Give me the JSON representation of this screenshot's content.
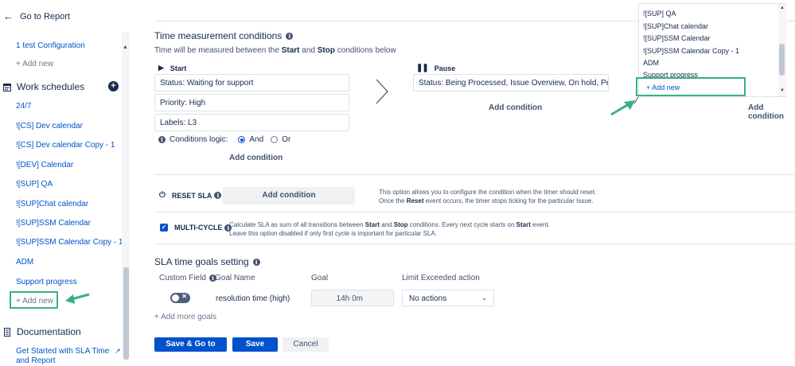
{
  "sidebar": {
    "back_label": "Go to Report",
    "test_config": "1 test Configuration",
    "add_new_top": "+ Add new",
    "work_schedules_label": "Work schedules",
    "schedules": [
      "24/7",
      "![CS] Dev calendar",
      "![CS] Dev calendar Copy - 1",
      "![DEV] Calendar",
      "![SUP] QA",
      "![SUP]Chat calendar",
      "![SUP]SSM Calendar",
      "![SUP]SSM Calendar Copy - 1",
      "ADM",
      "Support progress"
    ],
    "add_new_bottom": "+ Add new",
    "documentation_label": "Documentation",
    "get_started": "Get Started with SLA Time",
    "get_started_cont": "and Report"
  },
  "time_measurement": {
    "title": "Time measurement conditions",
    "subtitle_pre": "Time will be measured between the ",
    "subtitle_start": "Start",
    "subtitle_mid": " and ",
    "subtitle_stop": "Stop",
    "subtitle_post": " conditions below",
    "start_label": "Start",
    "start_conditions": [
      "Status: Waiting for support",
      "Priority: High",
      "Labels: L3"
    ],
    "conditions_logic_label": "Conditions logic:",
    "logic_and": "And",
    "logic_or": "Or",
    "add_condition": "Add condition",
    "pause_label": "Pause",
    "pause_condition": "Status: Being Processed, Issue Overview, On hold, Pending,...",
    "pause_add_condition": "Add condition",
    "stop_add_condition": "Add condition"
  },
  "reset_sla": {
    "label": "RESET SLA",
    "button": "Add condition",
    "note_line1": "This option allows you to configure the condition when the timer should reset.",
    "note_line2_pre": "Once the ",
    "note_line2_bold": "Reset",
    "note_line2_post": " event occurs, the timer stops ticking for the particular Issue."
  },
  "multi_cycle": {
    "label": "MULTI-CYCLE",
    "note_line1_a": "Calculate SLA as sum of all transitions between ",
    "note_line1_b": "Start",
    "note_line1_c": " and ",
    "note_line1_d": "Stop",
    "note_line1_e": " conditions. Every next cycle starts on ",
    "note_line1_f": "Start",
    "note_line1_g": " event.",
    "note_line2": "Leave this option disabled if only first cycle is important for particular SLA."
  },
  "goals": {
    "title": "SLA time goals setting",
    "col_custom_field": "Custom Field",
    "col_goal_name": "Goal Name",
    "col_goal": "Goal",
    "col_limit": "Limit Exceeded action",
    "row_name": "resolution time (high)",
    "row_goal": "14h 0m",
    "row_action": "No actions",
    "add_more": "+ Add more goals"
  },
  "footer": {
    "save_go": "Save & Go to report",
    "save": "Save",
    "cancel": "Cancel"
  },
  "dropdown": {
    "items": [
      "![SUP] QA",
      "![SUP]Chat calendar",
      "![SUP]SSM Calendar",
      "![SUP]SSM Calendar Copy - 1",
      "ADM",
      "Support progress"
    ],
    "add_new": "+ Add new"
  },
  "colors": {
    "accent": "#0052cc",
    "highlight": "#36b37e"
  }
}
